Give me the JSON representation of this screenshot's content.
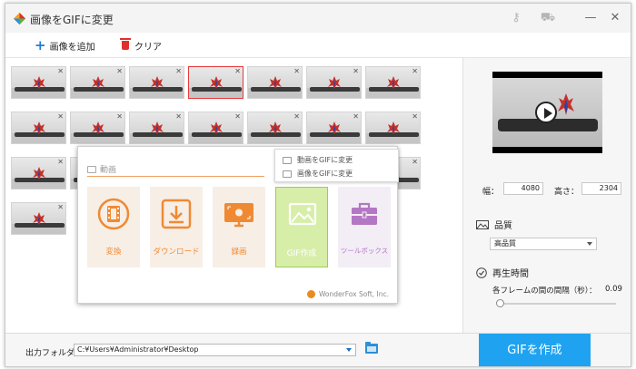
{
  "window": {
    "title": "画像をGIFに変更"
  },
  "toolbar": {
    "add_label": "画像を追加",
    "clear_label": "クリア"
  },
  "right_panel": {
    "width_label": "幅：",
    "width_value": "4080",
    "height_label": "高さ：",
    "height_value": "2304",
    "quality_title": "品質",
    "quality_value": "高品質",
    "playtime_title": "再生時間",
    "interval_label": "各フレームの間の間隔（秒）：",
    "interval_value": "0.09"
  },
  "bottom": {
    "output_label": "出力フォルダ：",
    "output_path": "C:¥Users¥Administrator¥Desktop",
    "create_label": "GIFを作成"
  },
  "popup": {
    "header": "動画",
    "tips": [
      "動画をGIFに変更",
      "画像をGIFに変更"
    ],
    "cards": [
      {
        "label": "変換",
        "icon": "convert-film-icon"
      },
      {
        "label": "ダウンロード",
        "icon": "download-icon"
      },
      {
        "label": "録画",
        "icon": "screen-record-icon"
      },
      {
        "label": "GIF作成",
        "icon": "gif-image-icon"
      },
      {
        "label": "ツールボックス",
        "icon": "toolbox-icon"
      }
    ],
    "brand": "WonderFox Soft, Inc."
  },
  "thumbnails": {
    "count": 22,
    "selected_index": 3
  },
  "colors": {
    "accent": "#1fa3f0",
    "orange": "#f08a32",
    "green": "#9ccc5a",
    "purple": "#b477c3",
    "selection": "#e43a3a"
  }
}
